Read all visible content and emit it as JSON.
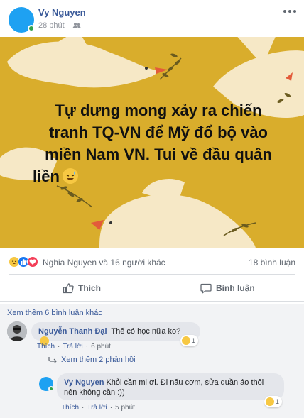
{
  "post": {
    "author": "Vy Nguyen",
    "time": "28 phút",
    "privacy_icon": "friends-icon",
    "text_lines": [
      "Tự dưng mong xảy ra chiến",
      "tranh TQ-VN để Mỹ đổ bộ vào",
      "miền Nam VN. Tui về đầu quân",
      "liền"
    ],
    "background_color": "#d9ad2c"
  },
  "reactions": {
    "icons": [
      "haha-icon",
      "like-icon",
      "love-icon"
    ],
    "summary": "Nghia Nguyen và 16 người khác",
    "comment_count": "18 bình luận"
  },
  "actions": {
    "like_label": "Thích",
    "comment_label": "Bình luận"
  },
  "comments": {
    "view_more": "Xem thêm 6 bình luận khác",
    "items": [
      {
        "name": "Nguyễn Thanh Đại",
        "text": "Thế có học nữa ko?",
        "like": "Thích",
        "reply": "Trả lời",
        "time": "6 phút",
        "reaction_count": "1"
      }
    ],
    "view_replies": "Xem thêm 2 phản hồi",
    "reply": {
      "name": "Vy Nguyen",
      "text_line1": "Khỏi cần mi ơi. Đi nấu cơm, sửa quần áo thôi",
      "text_line2": "nên không cần :))",
      "like": "Thích",
      "reply": "Trả lời",
      "time": "5 phút",
      "reaction_count": "1"
    }
  },
  "colors": {
    "link": "#385898",
    "avatar_blue": "#1ea1f2",
    "online": "#31a24c"
  }
}
